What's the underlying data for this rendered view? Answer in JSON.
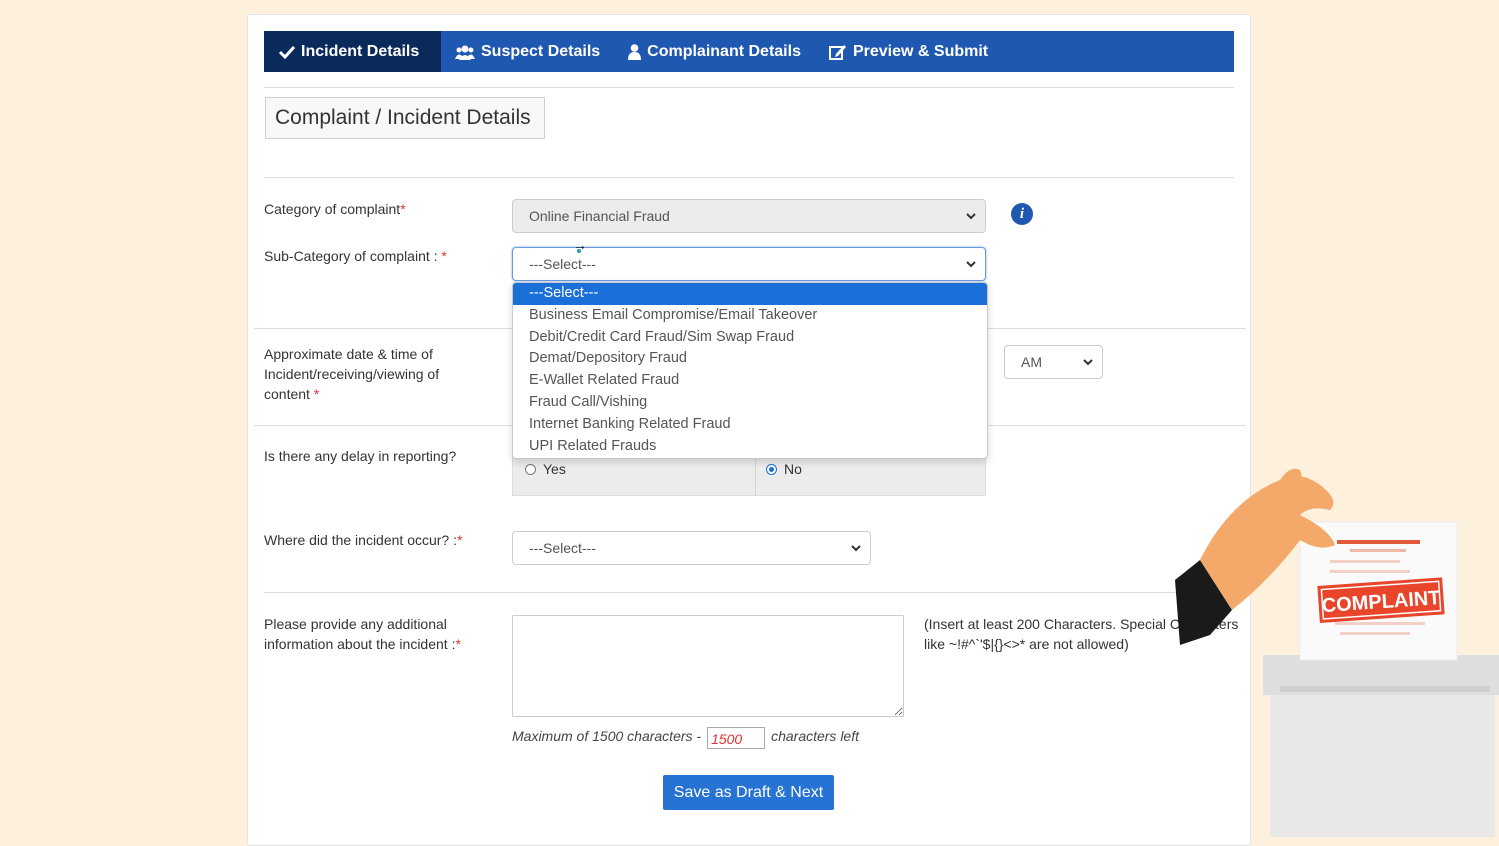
{
  "tabs": [
    {
      "label": "Incident Details",
      "icon": "check-icon",
      "active": true
    },
    {
      "label": "Suspect Details",
      "icon": "users-icon"
    },
    {
      "label": "Complainant Details",
      "icon": "user-icon"
    },
    {
      "label": "Preview & Submit",
      "icon": "edit-icon"
    }
  ],
  "section_title": "Complaint / Incident Details",
  "category": {
    "label": "Category of complaint",
    "required_mark": "*",
    "value": "Online Financial Fraud",
    "info_icon": "i"
  },
  "subcategory": {
    "label": "Sub-Category of complaint : ",
    "required_mark": "*",
    "value": "---Select---",
    "options": [
      "---Select---",
      "Business Email Compromise/Email Takeover",
      "Debit/Credit Card Fraud/Sim Swap Fraud",
      "Demat/Depository Fraud",
      "E-Wallet Related Fraud",
      "Fraud Call/Vishing",
      "Internet Banking Related Fraud",
      "UPI Related Frauds"
    ],
    "selected_index": 0
  },
  "date_time": {
    "label": "Approximate date & time of Incident/receiving/viewing of content",
    "required_mark": "*",
    "ampm_value": "AM"
  },
  "delay": {
    "label": "Is there any delay in reporting?",
    "options": [
      "Yes",
      "No"
    ],
    "selected": "No"
  },
  "location": {
    "label": "Where did the incident occur? :",
    "required_mark": "*",
    "value": "---Select---"
  },
  "additional": {
    "label": "Please provide any additional information about the incident :",
    "required_mark": "*",
    "note": "(Insert at least 200 Characters. Special Characters like ~!#^`'$|{}<>* are not allowed)",
    "max_prefix": "Maximum of 1500 characters - ",
    "counter": "1500",
    "max_suffix": " characters left"
  },
  "save_button": "Save as Draft & Next",
  "illustration": {
    "stamp": "COMPLAINT"
  },
  "colors": {
    "nav": "#1f58b1",
    "nav_active": "#0b2a5c",
    "button": "#2673d3",
    "required": "#e53030",
    "page_bg": "#fdf0dd"
  }
}
